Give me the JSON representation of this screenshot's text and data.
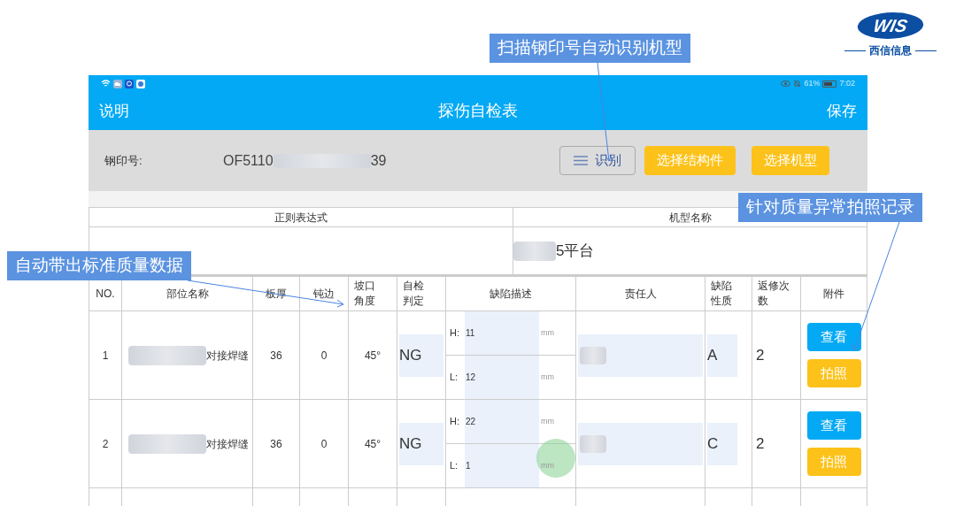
{
  "logo": {
    "mark": "WIS",
    "caption": "西信信息"
  },
  "callouts": [
    {
      "text": "扫描钢印号自动识别机型"
    },
    {
      "text": "自动带出标准质量数据"
    },
    {
      "text": "针对质量异常拍照记录"
    }
  ],
  "status_bar": {
    "battery": "61%",
    "time": "7:02"
  },
  "app_bar": {
    "left": "说明",
    "title": "探伤自检表",
    "right": "保存"
  },
  "stamp": {
    "label": "钢印号:",
    "value_start": "OF5110",
    "value_end": "39"
  },
  "actions": [
    {
      "kind": "outline",
      "label": "识别"
    },
    {
      "kind": "filled",
      "label": "选择结构件"
    },
    {
      "kind": "filled",
      "label": "选择机型"
    }
  ],
  "info_table": {
    "columns": [
      "正则表达式",
      "机型名称"
    ],
    "model_name_end": "5平台"
  },
  "table": {
    "columns": [
      "NO.",
      "部位名称",
      "板厚",
      "钝边",
      "坡口角度",
      "自检判定",
      "缺陷描述",
      "责任人",
      "缺陷性质",
      "返修次数",
      "附件"
    ],
    "rows": [
      {
        "no": "1",
        "part_end": "对接焊缝",
        "thickness": "36",
        "blunt_edge": "0",
        "angle": "45°",
        "judgement": "NG",
        "defects": [
          {
            "label": "H:",
            "value": "11",
            "unit": "mm"
          },
          {
            "label": "L:",
            "value": "12",
            "unit": "mm"
          }
        ],
        "nature": "A",
        "repairs": "2",
        "buttons": [
          "查看",
          "拍照"
        ],
        "touched": false
      },
      {
        "no": "2",
        "part_end": "对接焊缝",
        "thickness": "36",
        "blunt_edge": "0",
        "angle": "45°",
        "judgement": "NG",
        "defects": [
          {
            "label": "H:",
            "value": "22",
            "unit": "mm"
          },
          {
            "label": "L:",
            "value": "1",
            "unit": "mm"
          }
        ],
        "nature": "C",
        "repairs": "2",
        "buttons": [
          "查看",
          "拍照"
        ],
        "touched": true
      }
    ]
  }
}
